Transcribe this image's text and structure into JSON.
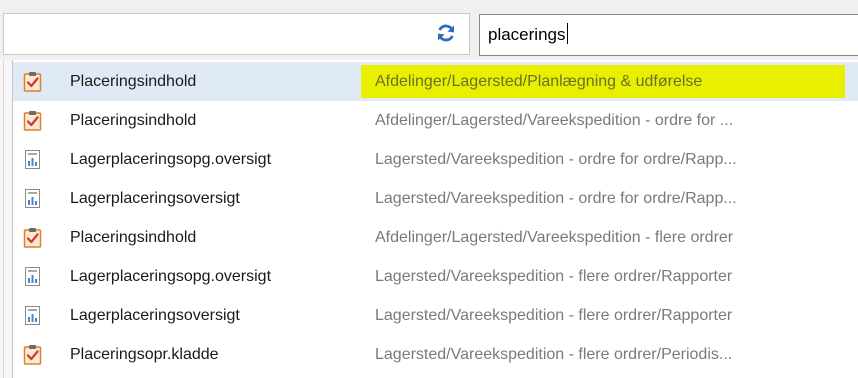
{
  "search": {
    "value": "placerings"
  },
  "icons": {
    "refresh": "refresh-icon",
    "report": "report-icon",
    "page": "clipboard-check-icon"
  },
  "colors": {
    "selected_row": "#dfeaf6",
    "highlight": "#e8f000",
    "path_text": "#7a7a7a"
  },
  "results": [
    {
      "name": "Placeringsindhold",
      "path": "Afdelinger/Lagersted/Planlægning & udførelse",
      "icon": "clipboard-check-icon",
      "selected": true,
      "highlighted": true
    },
    {
      "name": "Placeringsindhold",
      "path": "Afdelinger/Lagersted/Vareekspedition - ordre for ...",
      "icon": "clipboard-check-icon"
    },
    {
      "name": "Lagerplaceringsopg.oversigt",
      "path": "Lagersted/Vareekspedition - ordre for ordre/Rapp...",
      "icon": "report-icon"
    },
    {
      "name": "Lagerplaceringsoversigt",
      "path": "Lagersted/Vareekspedition - ordre for ordre/Rapp...",
      "icon": "report-icon"
    },
    {
      "name": "Placeringsindhold",
      "path": "Afdelinger/Lagersted/Vareekspedition - flere ordrer",
      "icon": "clipboard-check-icon"
    },
    {
      "name": "Lagerplaceringsopg.oversigt",
      "path": "Lagersted/Vareekspedition - flere ordrer/Rapporter",
      "icon": "report-icon"
    },
    {
      "name": "Lagerplaceringsoversigt",
      "path": "Lagersted/Vareekspedition - flere ordrer/Rapporter",
      "icon": "report-icon"
    },
    {
      "name": "Placeringsopr.kladde",
      "path": "Lagersted/Vareekspedition - flere ordrer/Periodis...",
      "icon": "clipboard-check-icon"
    }
  ]
}
